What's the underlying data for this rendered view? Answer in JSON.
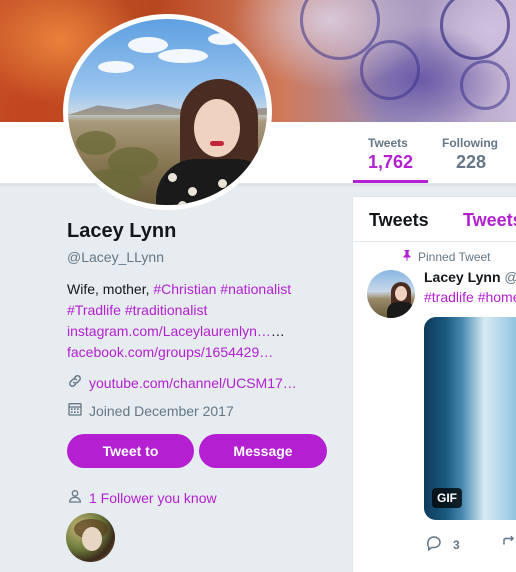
{
  "profile": {
    "name": "Lacey Lynn",
    "handle": "@Lacey_LLynn",
    "bio_plain_1": "Wife, mother, ",
    "bio_tag_1": "#Christian #nationalist",
    "bio_tag_2": "#Tradlife #traditionalist",
    "bio_link_1": "instagram.com/Laceylaurenlyn…",
    "bio_ellipsis": "…",
    "bio_link_2": "facebook.com/groups/1654429…",
    "website": "youtube.com/channel/UCSM17…",
    "joined": "Joined December 2017",
    "followers_you_know": "1 Follower you know"
  },
  "stats": {
    "tweets_label": "Tweets",
    "tweets_value": "1,762",
    "following_label": "Following",
    "following_value": "228"
  },
  "buttons": {
    "tweet_to": "Tweet to",
    "message": "Message"
  },
  "timeline": {
    "tab_tweets": "Tweets",
    "tab_tweets_replies": "Tweets",
    "pinned_label": "Pinned Tweet",
    "tweet_name": "Lacey Lynn",
    "tweet_handle": "@L",
    "tweet_tags": "#tradlife #home",
    "gif_label": "GIF",
    "reply_count": "3"
  },
  "colors": {
    "accent": "#b31fd1",
    "secondary_text": "#657786",
    "background": "#e6ecf0"
  },
  "icons": [
    "link-icon",
    "calendar-icon",
    "person-icon",
    "pin-icon",
    "reply-icon",
    "retweet-icon"
  ]
}
